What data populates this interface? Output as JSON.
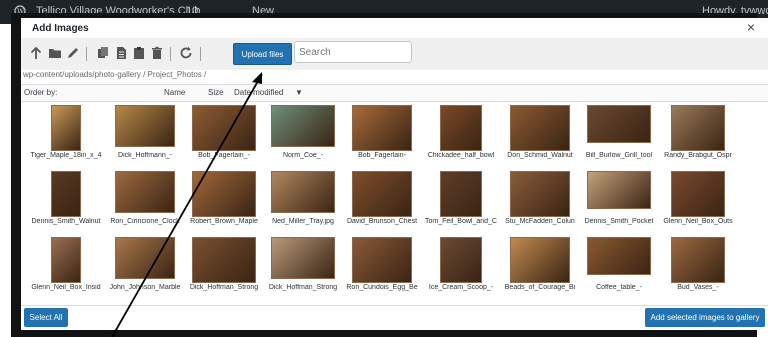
{
  "adminbar": {
    "site_name": "Tellico Village Woodworker's Club",
    "updates": "10",
    "new_label": "New",
    "howdy": "Howdy, tvwwc"
  },
  "modal": {
    "title": "Add Images",
    "close": "×"
  },
  "toolbar": {
    "upload_label": "Upload files",
    "search_placeholder": "Search"
  },
  "breadcrumb": "wp-content/uploads/photo-gallery / Project_Photos /",
  "sort": {
    "order_by": "Order by:",
    "name": "Name",
    "size": "Size",
    "date_modified": "Date modified",
    "arrow": "▼"
  },
  "items": [
    {
      "caption": "Tiger_Maple_18in_x_4",
      "color": "#c89a58"
    },
    {
      "caption": "Dick_Hoffmann_-",
      "color": "#b5884a"
    },
    {
      "caption": "Bob_Fagerlain_-",
      "color": "#8e5c33"
    },
    {
      "caption": "Norm_Coe_-",
      "color": "#6f8f7a"
    },
    {
      "caption": "Bob_Fagerlain-",
      "color": "#a66a3a"
    },
    {
      "caption": "Chickadee_half_bowl",
      "color": "#7a4a28"
    },
    {
      "caption": "Don_Schmid_Walnut",
      "color": "#8a5a32"
    },
    {
      "caption": "Bill_Burlow_Grill_tool",
      "color": "#6a4a30"
    },
    {
      "caption": "Randy_Brabgut_Ospr",
      "color": "#9a7a5a"
    },
    {
      "caption": "Dennis_Smith_Walnut",
      "color": "#5a3a22"
    },
    {
      "caption": "Ron_Cirincione_Clock",
      "color": "#9c6a40"
    },
    {
      "caption": "Robert_Brown_Maple",
      "color": "#a0683a"
    },
    {
      "caption": "Ned_Miller_Tray.jpg",
      "color": "#b08860"
    },
    {
      "caption": "David_Brunson_Chest",
      "color": "#7e4e2c"
    },
    {
      "caption": "Tom_Feil_Bowl_and_C",
      "color": "#5e3e28"
    },
    {
      "caption": "Stu_McFadden_Colun",
      "color": "#8a5c3a"
    },
    {
      "caption": "Dennis_Smith_Pocket",
      "color": "#c4a27a"
    },
    {
      "caption": "Glenn_Neil_Box_Outs",
      "color": "#7a4a2e"
    },
    {
      "caption": "Glenn_Neil_Box_Insid",
      "color": "#9a7050"
    },
    {
      "caption": "John_Johnson_Marble",
      "color": "#a8784a"
    },
    {
      "caption": "Dick_Hoffman_Strong",
      "color": "#7a5030"
    },
    {
      "caption": "Dick_Hoffman_Strong",
      "color": "#b89a7a"
    },
    {
      "caption": "Ron_Cundois_Egg_Be",
      "color": "#8a5a38"
    },
    {
      "caption": "Ice_Cream_Scoop_-",
      "color": "#6a4a34"
    },
    {
      "caption": "Beads_of_Courage_Bi",
      "color": "#c08a50"
    },
    {
      "caption": "Coffee_table_-",
      "color": "#8a5a30"
    },
    {
      "caption": "Bud_Vases_-",
      "color": "#9a6a40"
    }
  ],
  "footer": {
    "select_all": "Select All",
    "add_selected": "Add selected images to gallery"
  },
  "colors": {
    "accent": "#2271b1",
    "adminbar": "#1d2327",
    "toolbar_bg": "#f0f0f1"
  }
}
